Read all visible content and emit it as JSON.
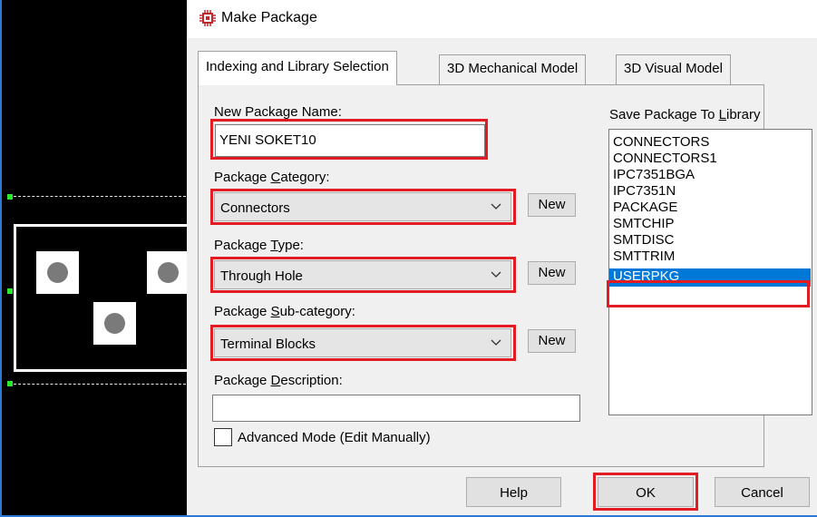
{
  "window": {
    "title": "Make Package",
    "icon": "chip-icon"
  },
  "tabs": [
    {
      "label": "Indexing and Library Selection",
      "active": true
    },
    {
      "label": "3D Mechanical Model",
      "active": false
    },
    {
      "label": "3D Visual Model",
      "active": false
    }
  ],
  "form": {
    "name_label": {
      "pre": "New Package Name:",
      "accel": "",
      "post": ""
    },
    "name_value": "YENI SOKET10",
    "category_label": {
      "pre": "Package ",
      "accel": "C",
      "post": "ategory:"
    },
    "category_value": "Connectors",
    "type_label": {
      "pre": "Package ",
      "accel": "T",
      "post": "ype:"
    },
    "type_value": "Through Hole",
    "subcategory_label": {
      "pre": "Package ",
      "accel": "S",
      "post": "ub-category:"
    },
    "subcategory_value": "Terminal Blocks",
    "description_label": {
      "pre": "Package ",
      "accel": "D",
      "post": "escription:"
    },
    "description_value": "",
    "new_button_label": "New",
    "advanced_label": "Advanced Mode (Edit Manually)",
    "advanced_checked": false
  },
  "library": {
    "label": {
      "pre": "Save Package To ",
      "accel": "L",
      "post": "ibrary"
    },
    "items": [
      "CONNECTORS",
      "CONNECTORS1",
      "IPC7351BGA",
      "IPC7351N",
      "PACKAGE",
      "SMTCHIP",
      "SMTDISC",
      "SMTTRIM",
      "USERPKG"
    ],
    "selected": "USERPKG"
  },
  "buttons": {
    "help": "Help",
    "ok": "OK",
    "cancel": "Cancel"
  },
  "colors": {
    "highlight": "#e31b23",
    "selection": "#0078d7",
    "canvas_bg": "#000000",
    "marker": "#2ee82e"
  }
}
